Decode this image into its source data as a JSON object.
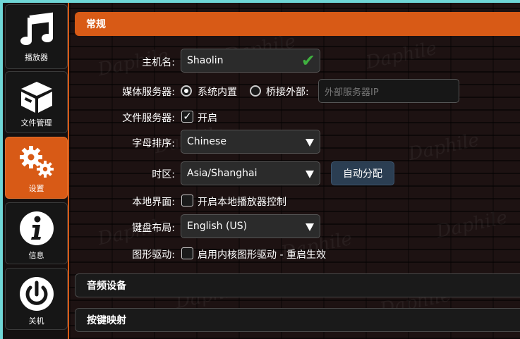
{
  "sidebar": {
    "items": [
      {
        "label": "播放器",
        "icon": "music-note-icon"
      },
      {
        "label": "文件管理",
        "icon": "box-icon"
      },
      {
        "label": "设置",
        "icon": "gears-icon"
      },
      {
        "label": "信息",
        "icon": "info-icon"
      },
      {
        "label": "关机",
        "icon": "power-icon"
      }
    ],
    "active": "设置"
  },
  "watermark": "Daphile",
  "sections": {
    "general": "常规",
    "audio": "音频设备",
    "keymap": "按键映射"
  },
  "form": {
    "hostname": {
      "label": "主机名:",
      "value": "Shaolin",
      "valid_icon": "checkmark-icon"
    },
    "media_server": {
      "label": "媒体服务器:",
      "option_internal": "系统内置",
      "option_external": "桥接外部:",
      "selected": "系统内置",
      "external_placeholder": "外部服务器IP"
    },
    "file_server": {
      "label": "文件服务器:",
      "checkbox_text": "开启",
      "checked": true
    },
    "alpha_sort": {
      "label": "字母排序:",
      "value": "Chinese"
    },
    "timezone": {
      "label": "时区:",
      "value": "Asia/Shanghai",
      "auto_button": "自动分配"
    },
    "local_ui": {
      "label": "本地界面:",
      "checkbox_text": "开启本地播放器控制",
      "checked": false
    },
    "keyboard": {
      "label": "键盘布局:",
      "value": "English (US)"
    },
    "graphics": {
      "label": "图形驱动:",
      "checkbox_text": "启用内核图形驱动 - 重启生效",
      "checked": false
    }
  },
  "colors": {
    "accent": "#d85a16",
    "border_cyan": "#6fd6d6",
    "button": "#2b3e52",
    "check_green": "#3fb03f"
  }
}
